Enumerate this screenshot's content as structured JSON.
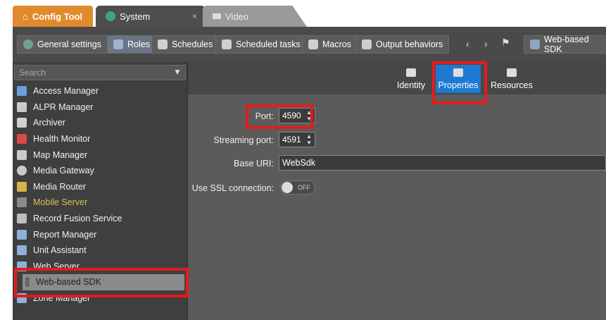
{
  "tabs": [
    {
      "label": "Config Tool",
      "icon": "home-icon"
    },
    {
      "label": "System",
      "icon": "globe-icon",
      "close": "×"
    },
    {
      "label": "Video",
      "icon": "video-icon"
    }
  ],
  "toolbar": {
    "items": [
      {
        "label": "General settings",
        "icon": "gear-icon"
      },
      {
        "label": "Roles",
        "icon": "roles-icon"
      },
      {
        "label": "Schedules",
        "icon": "calendar-icon"
      },
      {
        "label": "Scheduled tasks",
        "icon": "scheduled-task-icon"
      },
      {
        "label": "Macros",
        "icon": "macro-icon"
      },
      {
        "label": "Output behaviors",
        "icon": "output-icon"
      }
    ],
    "back": "‹",
    "forward": "›",
    "entity_label": "Web-based SDK"
  },
  "search": {
    "placeholder": "Search"
  },
  "roles": [
    {
      "label": "Access Manager",
      "icon": "access-manager-icon"
    },
    {
      "label": "ALPR Manager",
      "icon": "alpr-icon"
    },
    {
      "label": "Archiver",
      "icon": "archiver-icon"
    },
    {
      "label": "Health Monitor",
      "icon": "health-icon"
    },
    {
      "label": "Map Manager",
      "icon": "map-icon"
    },
    {
      "label": "Media Gateway",
      "icon": "gateway-icon"
    },
    {
      "label": "Media Router",
      "icon": "router-icon"
    },
    {
      "label": "Mobile Server",
      "icon": "mobile-icon"
    },
    {
      "label": "Record Fusion Service",
      "icon": "fusion-icon"
    },
    {
      "label": "Report Manager",
      "icon": "report-icon"
    },
    {
      "label": "Unit Assistant",
      "icon": "unit-icon"
    },
    {
      "label": "Web Server",
      "icon": "web-icon"
    },
    {
      "label": "Web-based SDK",
      "icon": "sdk-icon"
    },
    {
      "label": "Zone Manager",
      "icon": "zone-icon"
    }
  ],
  "content_tabs": [
    {
      "label": "Identity",
      "icon": "identity-icon"
    },
    {
      "label": "Properties",
      "icon": "properties-icon"
    },
    {
      "label": "Resources",
      "icon": "resources-icon"
    }
  ],
  "form": {
    "port_label": "Port:",
    "port_value": "4590",
    "streaming_label": "Streaming port:",
    "streaming_value": "4591",
    "base_uri_label": "Base URI:",
    "base_uri_value": "WebSdk",
    "ssl_label": "Use SSL connection:",
    "ssl_state": "OFF"
  },
  "colors": {
    "accent": "#1c7ad2",
    "highlight": "#e51b1b",
    "config_tab": "#e08a2e"
  }
}
